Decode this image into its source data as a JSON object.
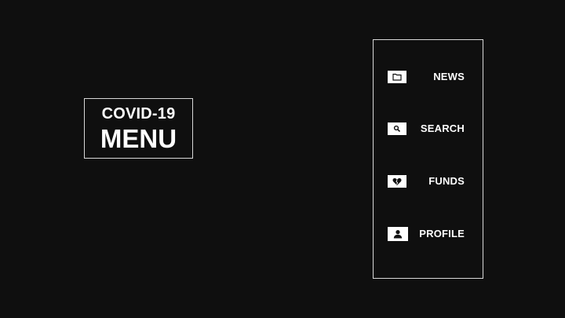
{
  "title": {
    "line1": "COVID-19",
    "line2": "MENU"
  },
  "menu": {
    "items": [
      {
        "label": "NEWS",
        "icon": "folder-icon"
      },
      {
        "label": "SEARCH",
        "icon": "search-icon"
      },
      {
        "label": "FUNDS",
        "icon": "heart-icon"
      },
      {
        "label": "PROFILE",
        "icon": "person-icon"
      }
    ]
  },
  "colors": {
    "background": "#0f0f0f",
    "foreground": "#ffffff",
    "border": "#d8d8d8"
  }
}
